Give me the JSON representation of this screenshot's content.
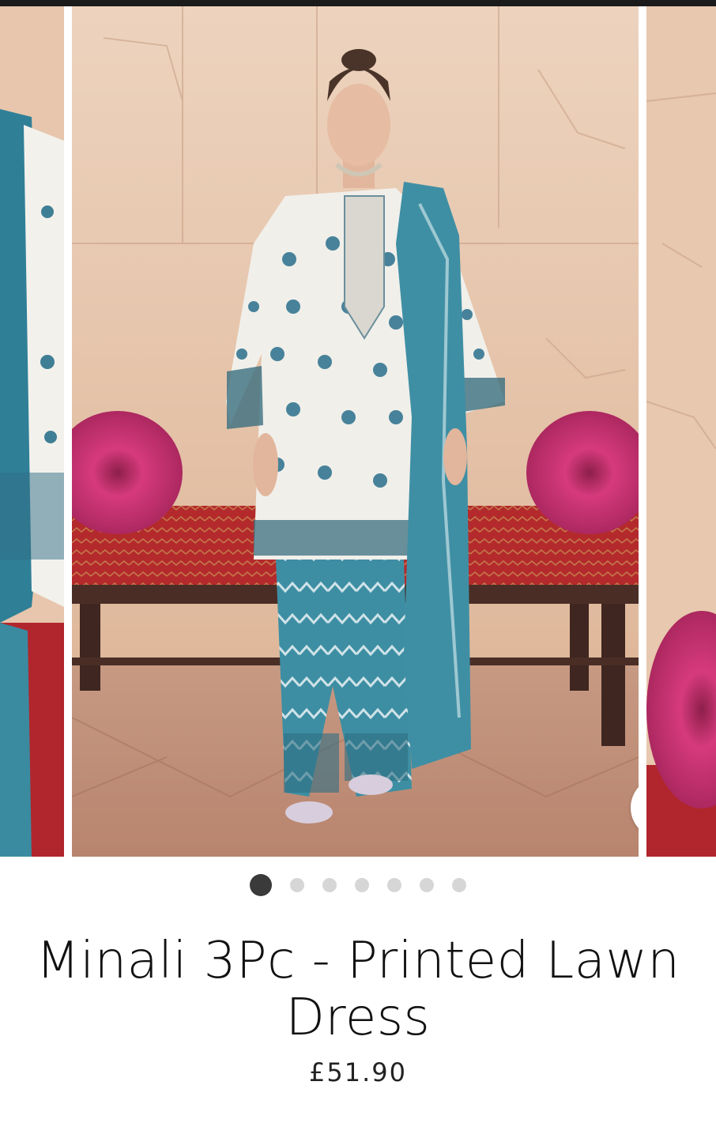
{
  "product": {
    "title": "Minali 3Pc - Printed Lawn Dress",
    "price": "£51.90"
  },
  "gallery": {
    "image_count": 7,
    "active_index": 0,
    "zoom_icon": "search-icon"
  },
  "colors": {
    "wall": "#e8c9b0",
    "bench_cushion": "#b32a2a",
    "bolster": "#d23a78",
    "dupatta": "#3f8fa4",
    "shirt": "#f1efea",
    "active_dot": "#3a3a3a",
    "inactive_dot": "#d6d6d6"
  }
}
